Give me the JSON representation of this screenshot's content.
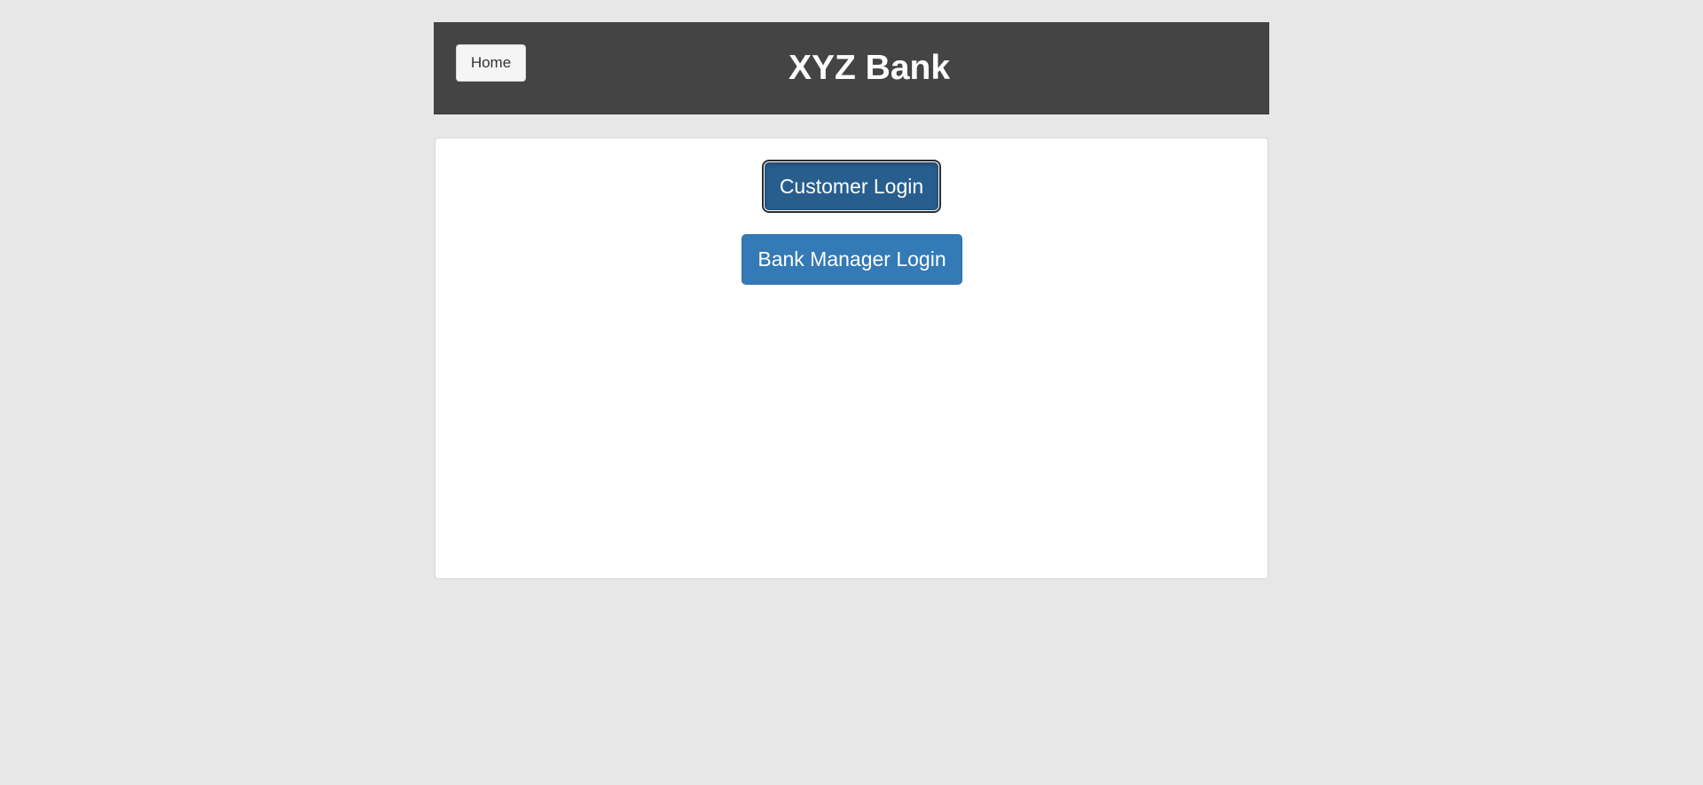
{
  "header": {
    "home_label": "Home",
    "title": "XYZ Bank"
  },
  "login": {
    "customer_label": "Customer Login",
    "manager_label": "Bank Manager Login"
  },
  "colors": {
    "background": "#e7e7e7",
    "header_bg": "#444444",
    "primary": "#337ab7",
    "primary_active": "#285e8e"
  }
}
